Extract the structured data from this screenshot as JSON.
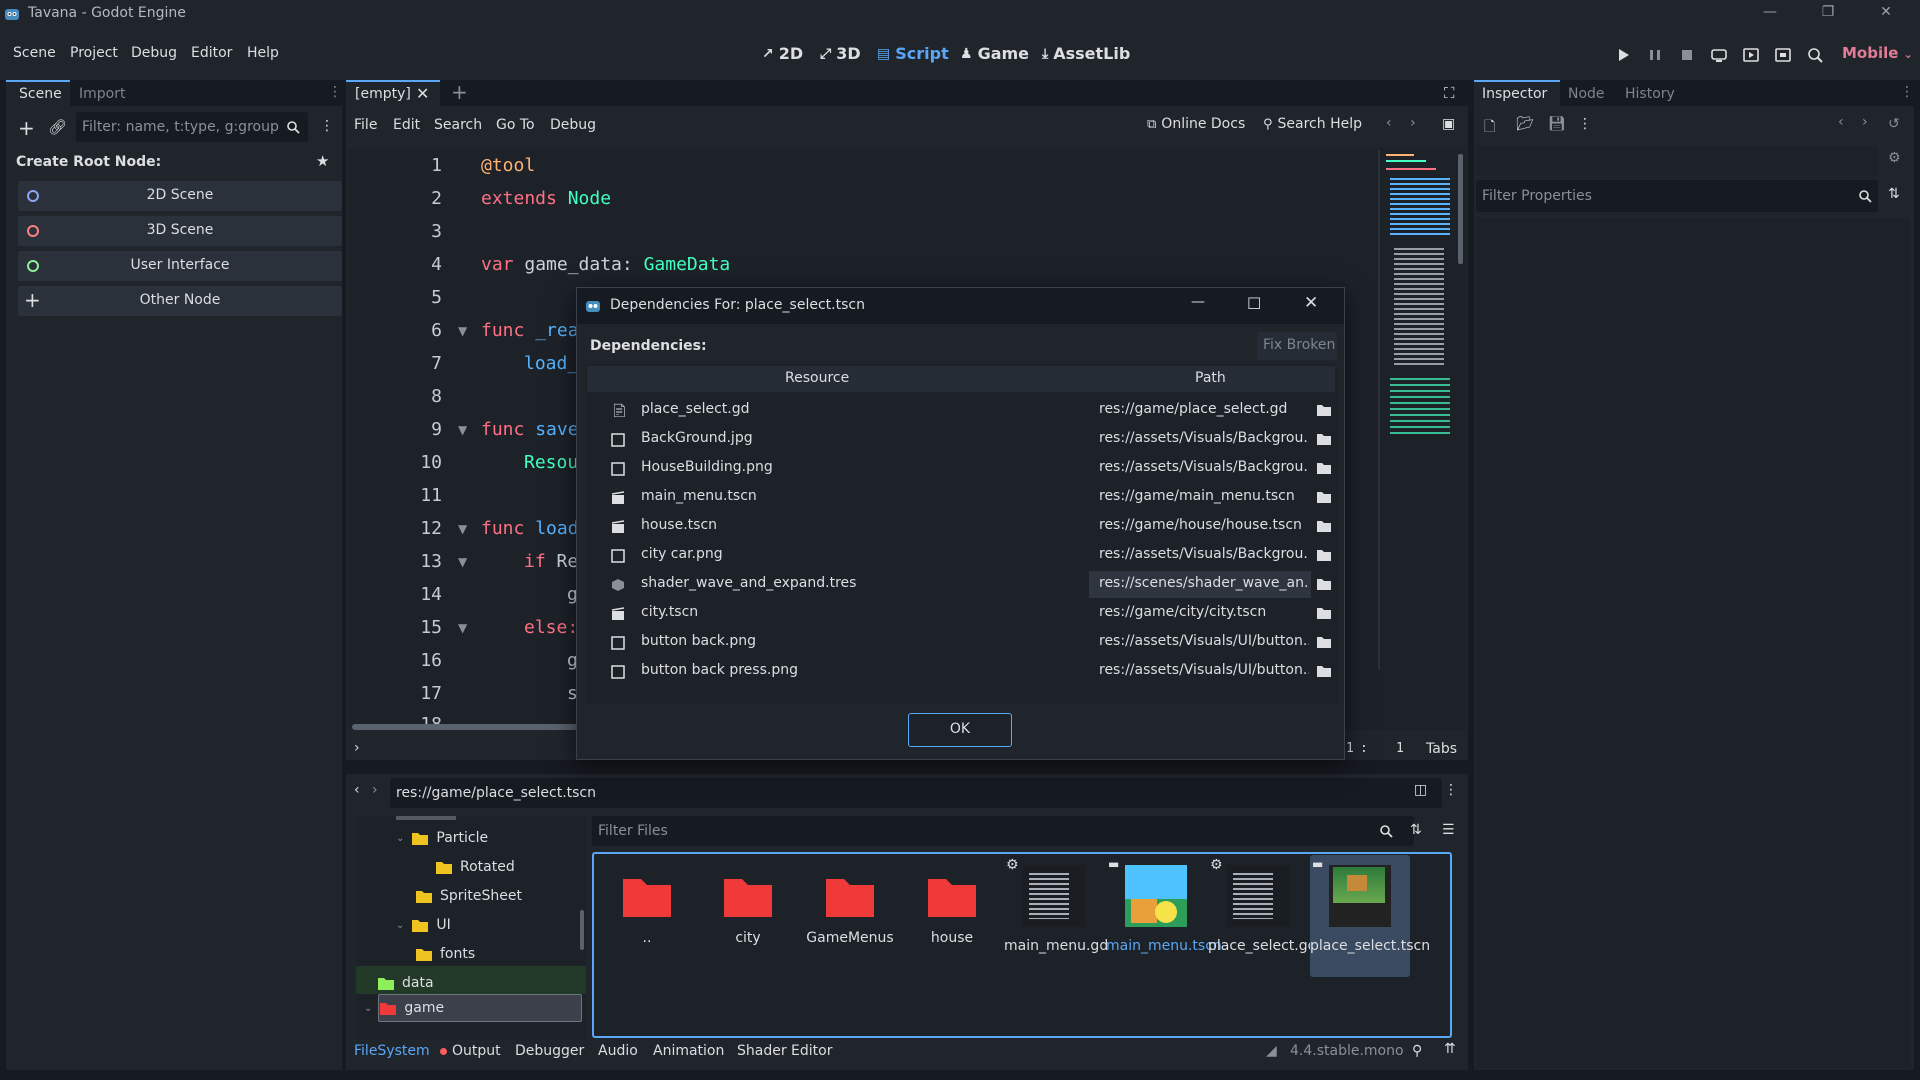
{
  "window": {
    "title": "Tavana - Godot Engine",
    "controls": [
      "minimize-icon",
      "restore-icon",
      "close-icon"
    ]
  },
  "menubar": {
    "menus": [
      "Scene",
      "Project",
      "Debug",
      "Editor",
      "Help"
    ],
    "workspaces": [
      {
        "label": "2D",
        "icon": "2d-icon"
      },
      {
        "label": "3D",
        "icon": "3d-icon"
      },
      {
        "label": "Script",
        "icon": "script-icon",
        "active": true
      },
      {
        "label": "Game",
        "icon": "game-icon"
      },
      {
        "label": "AssetLib",
        "icon": "assetlib-icon"
      }
    ],
    "renderer": "Mobile"
  },
  "scene_dock": {
    "tabs": [
      "Scene",
      "Import"
    ],
    "filter_placeholder": "Filter: name, t:type, g:group",
    "create_root_label": "Create Root Node:",
    "root_options": [
      {
        "label": "2D Scene",
        "color": "#8da5f3"
      },
      {
        "label": "3D Scene",
        "color": "#fc7f7f"
      },
      {
        "label": "User Interface",
        "color": "#8eef97"
      },
      {
        "label": "Other Node",
        "icon": "plus-icon"
      }
    ]
  },
  "editor": {
    "tab_label": "[empty]",
    "menu": [
      "File",
      "Edit",
      "Search",
      "Go To",
      "Debug"
    ],
    "online_docs": "Online Docs",
    "search_help": "Search Help",
    "line_numbers": [
      "1",
      "2",
      "3",
      "4",
      "5",
      "6",
      "7",
      "8",
      "9",
      "10",
      "11",
      "12",
      "13",
      "14",
      "15",
      "16",
      "17",
      "18"
    ],
    "lines": {
      "l1": "@tool",
      "l2_kw": "extends",
      "l2_ty": "Node",
      "l4_kw": "var",
      "l4_name": "game_data:",
      "l4_ty": "GameData",
      "l6_kw": "func",
      "l6_name": "_rea",
      "l7": "load_",
      "l9_kw": "func",
      "l9_name": "save",
      "l10": "Resou",
      "l12_kw": "func",
      "l12_name": "load",
      "l13_kw": "if",
      "l13_rest": "Re",
      "l14": "g",
      "l15_kw": "else:",
      "l16": "g",
      "l17": "s"
    },
    "status": {
      "line": "1",
      "col": "1",
      "indent": "Tabs"
    }
  },
  "dialog": {
    "title": "Dependencies For: place_select.tscn",
    "section_label": "Dependencies:",
    "fix_broken": "Fix Broken",
    "col_resource": "Resource",
    "col_path": "Path",
    "rows": [
      {
        "resource": "place_select.gd",
        "path": "res://game/place_select.gd",
        "icon": "script-file-icon"
      },
      {
        "resource": "BackGround.jpg",
        "path": "res://assets/Visuals/Backgrou...",
        "icon": "image-file-icon"
      },
      {
        "resource": "HouseBuilding.png",
        "path": "res://assets/Visuals/Backgrou...",
        "icon": "image-file-icon"
      },
      {
        "resource": "main_menu.tscn",
        "path": "res://game/main_menu.tscn",
        "icon": "scene-file-icon"
      },
      {
        "resource": "house.tscn",
        "path": "res://game/house/house.tscn",
        "icon": "scene-file-icon"
      },
      {
        "resource": "city car.png",
        "path": "res://assets/Visuals/Backgrou...",
        "icon": "image-file-icon"
      },
      {
        "resource": "shader_wave_and_expand.tres",
        "path": "res://scenes/shader_wave_an...",
        "icon": "resource-file-icon",
        "highlighted": true
      },
      {
        "resource": "city.tscn",
        "path": "res://game/city/city.tscn",
        "icon": "scene-file-icon"
      },
      {
        "resource": "button back.png",
        "path": "res://assets/Visuals/UI/button...",
        "icon": "image-file-icon"
      },
      {
        "resource": "button back press.png",
        "path": "res://assets/Visuals/UI/button...",
        "icon": "image-file-icon"
      }
    ],
    "ok_label": "OK"
  },
  "filesystem": {
    "path": "res://game/place_select.tscn",
    "filter_placeholder": "Filter Files",
    "tree": [
      {
        "label": "Particle",
        "expanded": true,
        "color": "#f0c420"
      },
      {
        "label": "Rotated",
        "color": "#f0c420"
      },
      {
        "label": "SpriteSheet",
        "color": "#f0c420"
      },
      {
        "label": "UI",
        "expanded": true,
        "color": "#f0c420"
      },
      {
        "label": "fonts",
        "color": "#f0c420"
      },
      {
        "label": "data",
        "color": "#8eef5a"
      },
      {
        "label": "game",
        "color": "#f03a3a",
        "selected": true
      }
    ],
    "files": [
      {
        "name": "..",
        "type": "folder"
      },
      {
        "name": "city",
        "type": "folder"
      },
      {
        "name": "GameMenus",
        "type": "folder"
      },
      {
        "name": "house",
        "type": "folder"
      },
      {
        "name": "main_menu.gd",
        "type": "script"
      },
      {
        "name": "main_menu.tscn",
        "type": "scene",
        "highlight": true
      },
      {
        "name": "place_select.gd",
        "type": "script"
      },
      {
        "name": "place_select.tscn",
        "type": "scene",
        "selected": true
      }
    ],
    "folder_color": "#f03a3a"
  },
  "bottom_tabs": [
    "FileSystem",
    "Output",
    "Debugger",
    "Audio",
    "Animation",
    "Shader Editor"
  ],
  "version": "4.4.stable.mono",
  "inspector": {
    "tabs": [
      "Inspector",
      "Node",
      "History"
    ],
    "filter_placeholder": "Filter Properties"
  }
}
